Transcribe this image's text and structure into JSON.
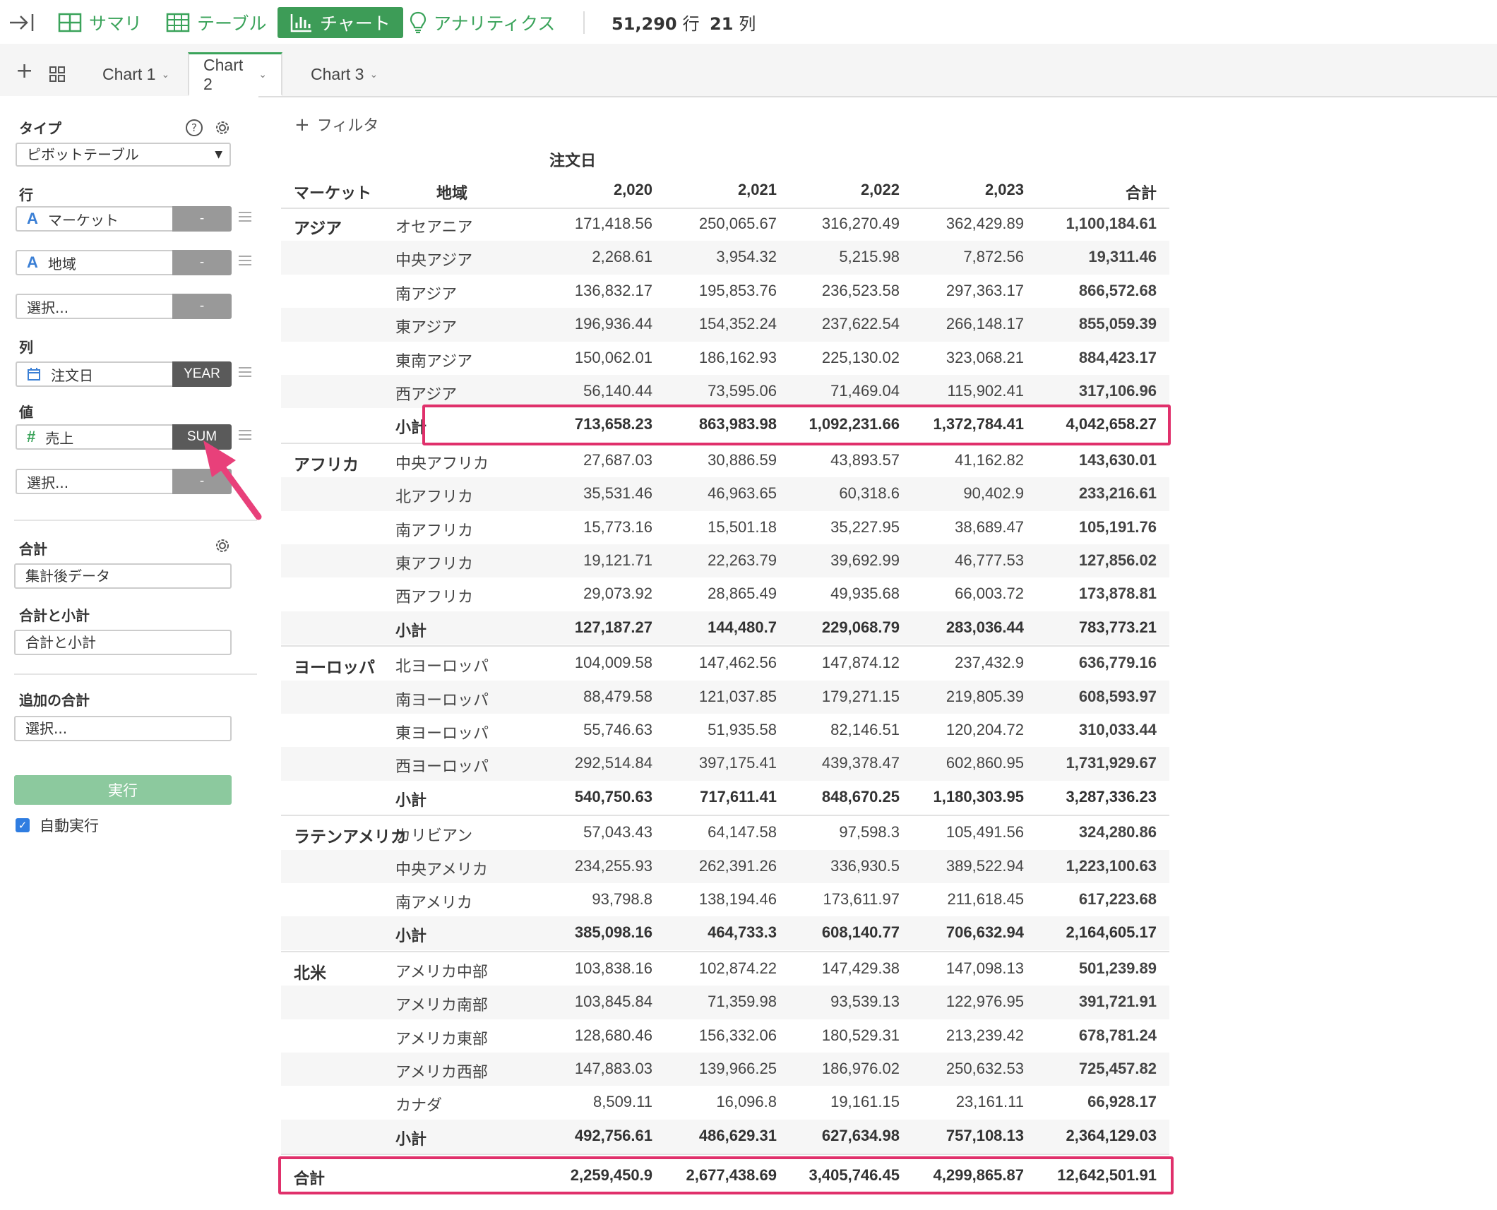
{
  "toolbar": {
    "summary": "サマリ",
    "table": "テーブル",
    "chart": "チャート",
    "analytics": "アナリティクス",
    "rows_count": "51,290",
    "rows_unit": "行",
    "cols_count": "21",
    "cols_unit": "列"
  },
  "tabs": [
    "Chart 1",
    "Chart 2",
    "Chart 3"
  ],
  "panel": {
    "type_label": "タイプ",
    "type_value": "ピボットテーブル",
    "row_label": "行",
    "row_fields": [
      "マーケット",
      "地域"
    ],
    "row_select": "選択...",
    "col_label": "列",
    "col_field": "注文日",
    "col_agg": "YEAR",
    "val_label": "値",
    "val_field": "売上",
    "val_agg": "SUM",
    "val_select": "選択...",
    "dash": "-",
    "total_label": "合計",
    "total_value": "集計後データ",
    "subtotal_label": "合計と小計",
    "subtotal_value": "合計と小計",
    "extra_label": "追加の合計",
    "extra_value": "選択...",
    "run": "実行",
    "auto_run": "自動実行"
  },
  "filter": "フィルタ",
  "pivot": {
    "column_group": "注文日",
    "headers": [
      "マーケット",
      "地域",
      "2,020",
      "2,021",
      "2,022",
      "2,023",
      "合計"
    ],
    "groups": [
      {
        "market": "アジア",
        "rows": [
          [
            "オセアニア",
            "171,418.56",
            "250,065.67",
            "316,270.49",
            "362,429.89",
            "1,100,184.61"
          ],
          [
            "中央アジア",
            "2,268.61",
            "3,954.32",
            "5,215.98",
            "7,872.56",
            "19,311.46"
          ],
          [
            "南アジア",
            "136,832.17",
            "195,853.76",
            "236,523.58",
            "297,363.17",
            "866,572.68"
          ],
          [
            "東アジア",
            "196,936.44",
            "154,352.24",
            "237,622.54",
            "266,148.17",
            "855,059.39"
          ],
          [
            "東南アジア",
            "150,062.01",
            "186,162.93",
            "225,130.02",
            "323,068.21",
            "884,423.17"
          ],
          [
            "西アジア",
            "56,140.44",
            "73,595.06",
            "71,469.04",
            "115,902.41",
            "317,106.96"
          ]
        ],
        "subtotal": [
          "小計",
          "713,658.23",
          "863,983.98",
          "1,092,231.66",
          "1,372,784.41",
          "4,042,658.27"
        ]
      },
      {
        "market": "アフリカ",
        "rows": [
          [
            "中央アフリカ",
            "27,687.03",
            "30,886.59",
            "43,893.57",
            "41,162.82",
            "143,630.01"
          ],
          [
            "北アフリカ",
            "35,531.46",
            "46,963.65",
            "60,318.6",
            "90,402.9",
            "233,216.61"
          ],
          [
            "南アフリカ",
            "15,773.16",
            "15,501.18",
            "35,227.95",
            "38,689.47",
            "105,191.76"
          ],
          [
            "東アフリカ",
            "19,121.71",
            "22,263.79",
            "39,692.99",
            "46,777.53",
            "127,856.02"
          ],
          [
            "西アフリカ",
            "29,073.92",
            "28,865.49",
            "49,935.68",
            "66,003.72",
            "173,878.81"
          ]
        ],
        "subtotal": [
          "小計",
          "127,187.27",
          "144,480.7",
          "229,068.79",
          "283,036.44",
          "783,773.21"
        ]
      },
      {
        "market": "ヨーロッパ",
        "rows": [
          [
            "北ヨーロッパ",
            "104,009.58",
            "147,462.56",
            "147,874.12",
            "237,432.9",
            "636,779.16"
          ],
          [
            "南ヨーロッパ",
            "88,479.58",
            "121,037.85",
            "179,271.15",
            "219,805.39",
            "608,593.97"
          ],
          [
            "東ヨーロッパ",
            "55,746.63",
            "51,935.58",
            "82,146.51",
            "120,204.72",
            "310,033.44"
          ],
          [
            "西ヨーロッパ",
            "292,514.84",
            "397,175.41",
            "439,378.47",
            "602,860.95",
            "1,731,929.67"
          ]
        ],
        "subtotal": [
          "小計",
          "540,750.63",
          "717,611.41",
          "848,670.25",
          "1,180,303.95",
          "3,287,336.23"
        ]
      },
      {
        "market": "ラテンアメリカ",
        "rows": [
          [
            "カリビアン",
            "57,043.43",
            "64,147.58",
            "97,598.3",
            "105,491.56",
            "324,280.86"
          ],
          [
            "中央アメリカ",
            "234,255.93",
            "262,391.26",
            "336,930.5",
            "389,522.94",
            "1,223,100.63"
          ],
          [
            "南アメリカ",
            "93,798.8",
            "138,194.46",
            "173,611.97",
            "211,618.45",
            "617,223.68"
          ]
        ],
        "subtotal": [
          "小計",
          "385,098.16",
          "464,733.3",
          "608,140.77",
          "706,632.94",
          "2,164,605.17"
        ]
      },
      {
        "market": "北米",
        "rows": [
          [
            "アメリカ中部",
            "103,838.16",
            "102,874.22",
            "147,429.38",
            "147,098.13",
            "501,239.89"
          ],
          [
            "アメリカ南部",
            "103,845.84",
            "71,359.98",
            "93,539.13",
            "122,976.95",
            "391,721.91"
          ],
          [
            "アメリカ東部",
            "128,680.46",
            "156,332.06",
            "180,529.31",
            "213,239.42",
            "678,781.24"
          ],
          [
            "アメリカ西部",
            "147,883.03",
            "139,966.25",
            "186,976.02",
            "250,632.53",
            "725,457.82"
          ],
          [
            "カナダ",
            "8,509.11",
            "16,096.8",
            "19,161.15",
            "23,161.11",
            "66,928.17"
          ]
        ],
        "subtotal": [
          "小計",
          "492,756.61",
          "486,629.31",
          "627,634.98",
          "757,108.13",
          "2,364,129.03"
        ]
      }
    ],
    "grand_total": [
      "合計",
      "2,259,450.9",
      "2,677,438.69",
      "3,405,746.45",
      "4,299,865.87",
      "12,642,501.91"
    ]
  },
  "colors": {
    "accent": "#3d9c57",
    "highlight": "#e0306b",
    "arrow": "#e8407a"
  },
  "icons": [
    "collapse-icon",
    "summary-icon",
    "table-icon",
    "chart-icon",
    "lightbulb-icon",
    "plus-icon",
    "grid-icon",
    "help-icon",
    "gear-icon",
    "text-type-icon",
    "calendar-icon",
    "number-type-icon",
    "drag-handle-icon",
    "checkbox-icon"
  ]
}
